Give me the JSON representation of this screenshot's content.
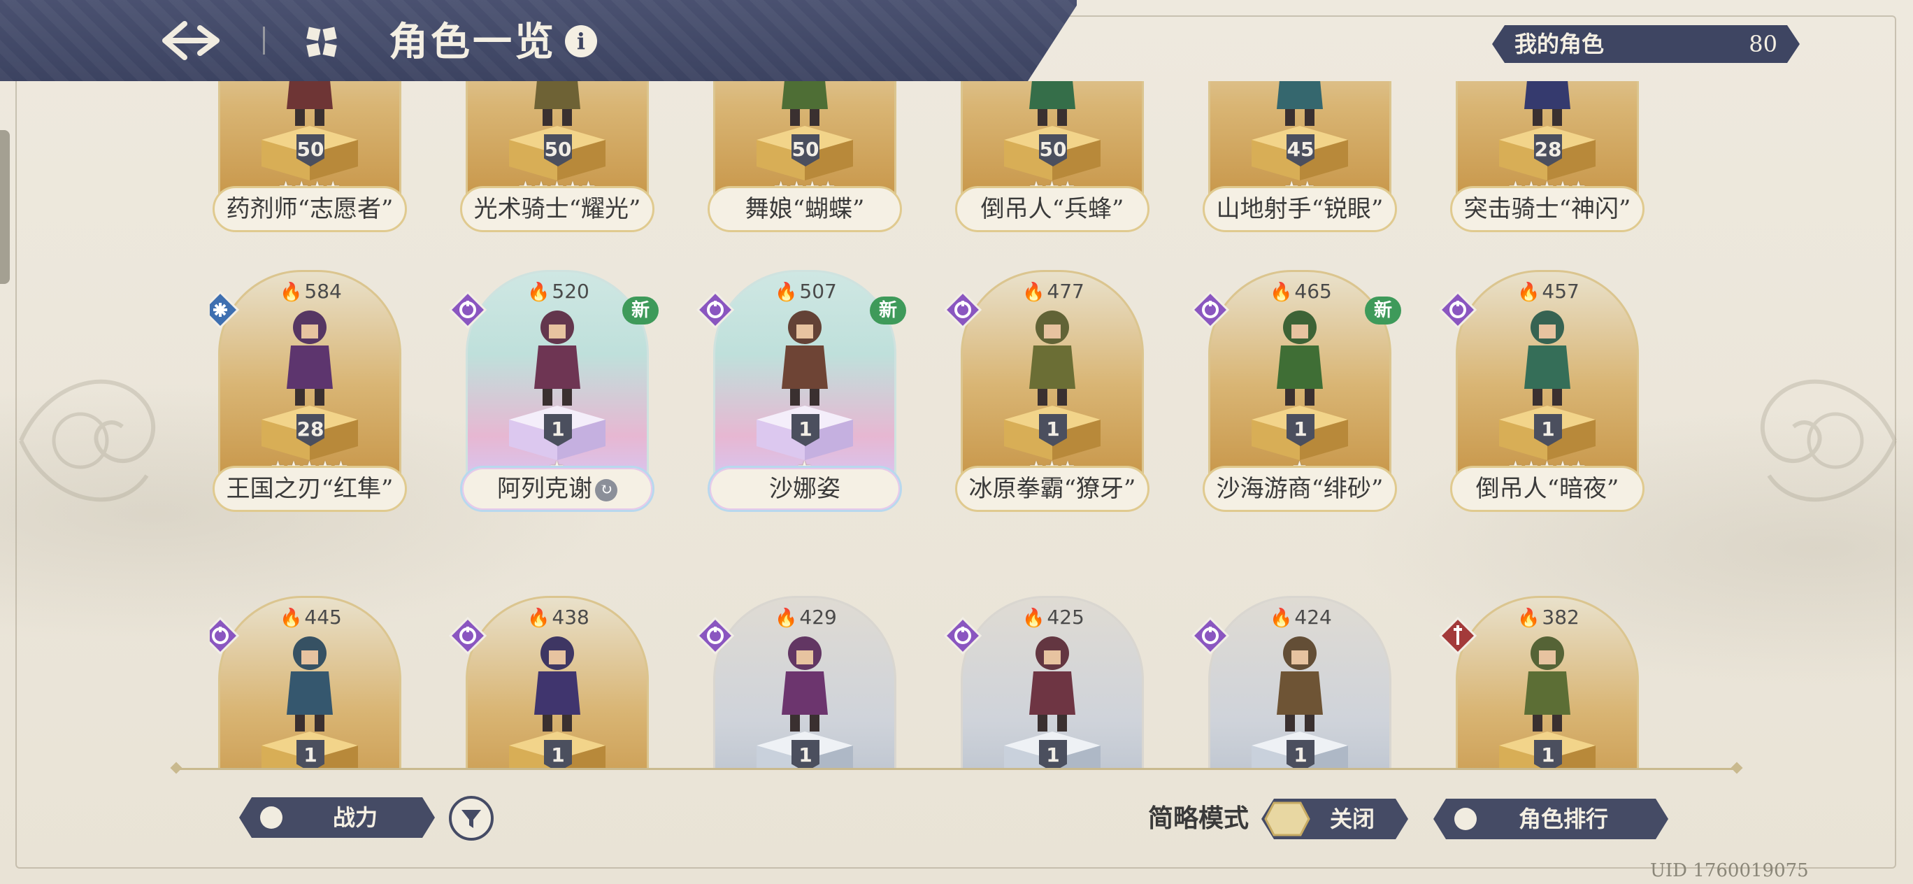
{
  "header": {
    "title": "角色一览"
  },
  "my_characters": {
    "label": "我的角色",
    "count": "80"
  },
  "rows": [
    [
      {
        "name": "药剂师“志愿者”",
        "level": "50",
        "stars": 4,
        "style": "gold"
      },
      {
        "name": "光术骑士“耀光”",
        "level": "50",
        "stars": 5,
        "style": "gold"
      },
      {
        "name": "舞娘“蝴蝶”",
        "level": "50",
        "stars": 4,
        "style": "gold"
      },
      {
        "name": "倒吊人“兵蜂”",
        "level": "50",
        "stars": 3,
        "style": "gold"
      },
      {
        "name": "山地射手“锐眼”",
        "level": "45",
        "stars": 2,
        "style": "gold"
      },
      {
        "name": "突击骑士“神闪”",
        "level": "28",
        "stars": 5,
        "style": "gold"
      }
    ],
    [
      {
        "name": "王国之刃“红隼”",
        "level": "28",
        "stars": 5,
        "power": "584",
        "element": "wind",
        "style": "gold"
      },
      {
        "name": "阿列克谢",
        "level": "1",
        "stars": 1,
        "power": "520",
        "element": "arcane",
        "style": "holo",
        "new": "新",
        "sub_icon": "true"
      },
      {
        "name": "沙娜姿",
        "level": "1",
        "stars": 1,
        "power": "507",
        "element": "arcane",
        "style": "holo",
        "new": "新"
      },
      {
        "name": "冰原拳霸“獠牙”",
        "level": "1",
        "stars": 3,
        "power": "477",
        "element": "arcane",
        "style": "gold"
      },
      {
        "name": "沙海游商“绯砂”",
        "level": "1",
        "stars": 1,
        "power": "465",
        "element": "arcane",
        "style": "gold",
        "new": "新"
      },
      {
        "name": "倒吊人“暗夜”",
        "level": "1",
        "stars": 5,
        "power": "457",
        "element": "arcane",
        "style": "gold"
      }
    ],
    [
      {
        "name": "",
        "level": "1",
        "stars": 0,
        "power": "445",
        "element": "arcane",
        "style": "gold"
      },
      {
        "name": "",
        "level": "1",
        "stars": 0,
        "power": "438",
        "element": "arcane",
        "style": "gold"
      },
      {
        "name": "",
        "level": "1",
        "stars": 0,
        "power": "429",
        "element": "arcane",
        "style": "silver"
      },
      {
        "name": "",
        "level": "1",
        "stars": 0,
        "power": "425",
        "element": "arcane",
        "style": "silver"
      },
      {
        "name": "",
        "level": "1",
        "stars": 0,
        "power": "424",
        "element": "arcane",
        "style": "silver"
      },
      {
        "name": "",
        "level": "1",
        "stars": 0,
        "power": "382",
        "element": "blade",
        "style": "gold"
      }
    ]
  ],
  "bottom": {
    "sort_label": "战力",
    "mode_label": "简略模式",
    "mode_value": "关闭",
    "ranking_label": "角色排行",
    "uid": "UID 1760019075"
  },
  "colors": {
    "header": "#3c4361",
    "accent_gold": "#dbc58f",
    "new_badge": "#3e9a5a",
    "element_arcane": "#8a56c0",
    "element_wind": "#3e6fb0",
    "element_blade": "#a33a3a"
  }
}
